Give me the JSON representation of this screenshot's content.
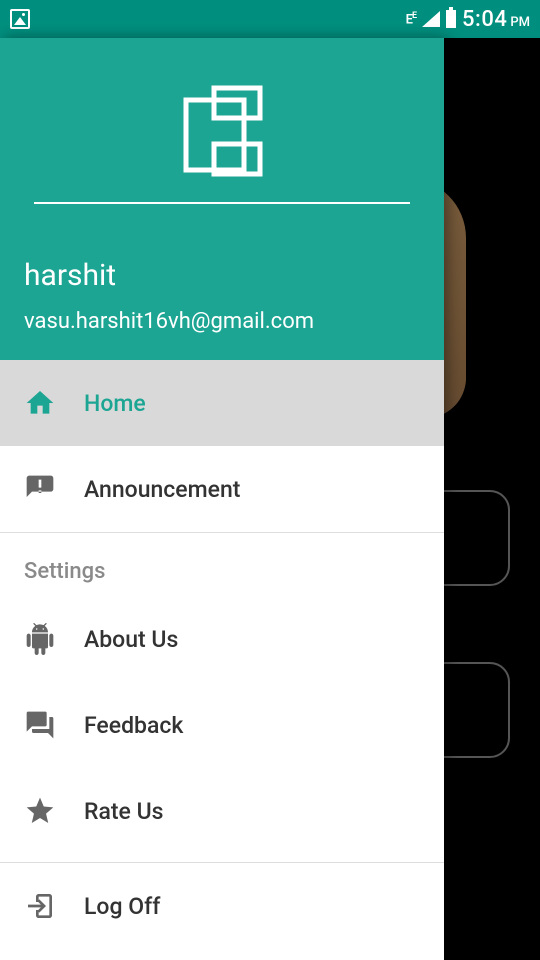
{
  "status_bar": {
    "network_label": "E",
    "superscript": "E",
    "time": "5:04",
    "ampm": "PM"
  },
  "drawer": {
    "username": "harshit",
    "email": "vasu.harshit16vh@gmail.com",
    "primary_items": [
      {
        "label": "Home",
        "icon": "home-icon",
        "active": true
      },
      {
        "label": "Announcement",
        "icon": "announcement-icon",
        "active": false
      }
    ],
    "settings_title": "Settings",
    "settings_items": [
      {
        "label": "About Us",
        "icon": "android-icon"
      },
      {
        "label": "Feedback",
        "icon": "feedback-icon"
      },
      {
        "label": "Rate Us",
        "icon": "star-icon"
      }
    ],
    "logoff_label": "Log Off"
  },
  "colors": {
    "primary": "#1da593",
    "primary_dark": "#008f7e",
    "active_bg": "#d9d9d9",
    "icon_inactive": "#666666"
  }
}
